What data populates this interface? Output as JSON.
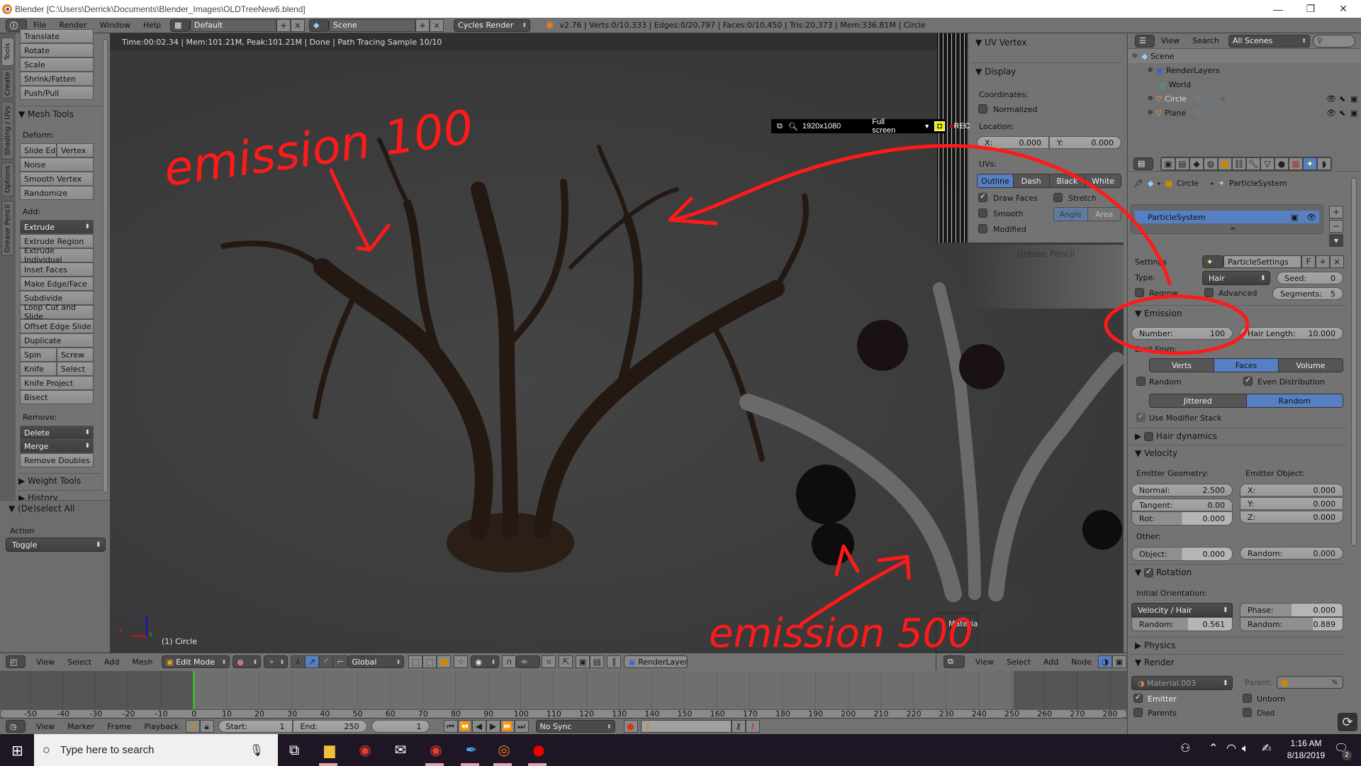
{
  "window": {
    "title": "Blender [C:\\Users\\Derrick\\Documents\\Blender_Images\\OLDTreeNew6.blend]",
    "controls": {
      "minimize": "—",
      "maximize": "❐",
      "close": "✕"
    }
  },
  "topbar": {
    "menus": [
      "File",
      "Render",
      "Window",
      "Help"
    ],
    "layout": "Default",
    "scene": "Scene",
    "engine": "Cycles Render",
    "stats": "v2.76 | Verts:0/10,333 | Edges:0/20,797 | Faces:0/10,450 | Tris:20,373 | Mem:336.81M | Circle"
  },
  "left_tabs": [
    "Tools",
    "Create",
    "Shading / UVs",
    "Options",
    "Grease Pencil"
  ],
  "tool_shelf": {
    "transform_buttons": [
      "Translate",
      "Rotate",
      "Scale",
      "Shrink/Fatten",
      "Push/Pull"
    ],
    "mesh_tools_header": "Mesh Tools",
    "deform_label": "Deform:",
    "deform_row": [
      "Slide Ed",
      "Vertex"
    ],
    "deform_buttons": [
      "Noise",
      "Smooth Vertex",
      "Randomize"
    ],
    "add_label": "Add:",
    "extrude_dropdown": "Extrude",
    "add_buttons": [
      "Extrude Region",
      "Extrude Individual",
      "Inset Faces",
      "Make Edge/Face",
      "Subdivide",
      "Loop Cut and Slide",
      "Offset Edge Slide",
      "Duplicate"
    ],
    "spin_row": [
      "Spin",
      "Screw"
    ],
    "knife_row": [
      "Knife",
      "Select"
    ],
    "more_buttons": [
      "Knife Project",
      "Bisect"
    ],
    "remove_label": "Remove:",
    "delete_dropdown": "Delete",
    "merge_dropdown": "Merge",
    "remove_doubles": "Remove Doubles",
    "weight_tools": "Weight Tools",
    "history": "History"
  },
  "redo_panel": {
    "header": "(De)select All",
    "action_label": "Action",
    "action_value": "Toggle"
  },
  "viewport": {
    "render_info": "Time:00:02.34 | Mem:101.21M, Peak:101.21M | Done | Path Tracing Sample 10/10",
    "object_label": "(1) Circle",
    "axis": {
      "x": "x",
      "y": "y",
      "z": "z"
    },
    "material_preview": "Materia",
    "faded_panel": "Grease Pencil"
  },
  "uv_panel": {
    "uv_vertex_header": "UV Vertex",
    "display_header": "Display",
    "coordinates_label": "Coordinates:",
    "normalized": {
      "label": "Normalized",
      "checked": false
    },
    "location_label": "Location:",
    "x_label": "X:",
    "x_value": "0.000",
    "y_label": "Y:",
    "y_value": "0.000",
    "uvs_label": "UVs:",
    "uv_modes": [
      "Outline",
      "Dash",
      "Black",
      "White"
    ],
    "uv_mode_active": "Outline",
    "draw_faces": {
      "label": "Draw Faces",
      "checked": true
    },
    "stretch": {
      "label": "Stretch",
      "checked": false
    },
    "smooth": {
      "label": "Smooth",
      "checked": false
    },
    "stretch_modes": [
      "Angle",
      "Area"
    ],
    "modified": {
      "label": "Modified",
      "checked": false
    }
  },
  "recorder": {
    "resolution": "1920x1080",
    "mode": "Full screen",
    "rec_label": "REC"
  },
  "outliner": {
    "menus": [
      "View",
      "Search"
    ],
    "filter": "All Scenes",
    "tree": [
      {
        "name": "Scene",
        "level": 0
      },
      {
        "name": "RenderLayers",
        "level": 1
      },
      {
        "name": "World",
        "level": 1
      },
      {
        "name": "Circle",
        "level": 1
      },
      {
        "name": "Plane",
        "level": 1
      }
    ]
  },
  "properties": {
    "breadcrumb": [
      "Circle",
      "ParticleSystem"
    ],
    "particle_system": "ParticleSystem",
    "settings_label": "Settings",
    "settings_value": "ParticleSettings",
    "settings_users": "F",
    "type_label": "Type:",
    "type_value": "Hair",
    "seed_label": "Seed:",
    "seed_value": "0",
    "regrow": {
      "label": "Regrow",
      "checked": false
    },
    "advanced": {
      "label": "Advanced",
      "checked": false
    },
    "segments_label": "Segments:",
    "segments_value": "5",
    "emission": {
      "header": "Emission",
      "number_label": "Number:",
      "number_value": "100",
      "hair_length_label": "Hair Length:",
      "hair_length_value": "10.000",
      "emit_from_label": "Emit From:",
      "emit_from": [
        "Verts",
        "Faces",
        "Volume"
      ],
      "emit_from_active": "Faces",
      "random": {
        "label": "Random",
        "checked": false
      },
      "even_distribution": {
        "label": "Even Distribution",
        "checked": true
      },
      "distribution": [
        "Jittered",
        "Random"
      ],
      "distribution_active": "Random",
      "use_modifier_stack": {
        "label": "Use Modifier Stack",
        "checked": true
      }
    },
    "hair_dynamics": {
      "label": "Hair dynamics",
      "checked": false
    },
    "velocity": {
      "header": "Velocity",
      "emitter_geometry": "Emitter Geometry:",
      "emitter_object": "Emitter Object:",
      "normal_label": "Normal:",
      "normal_value": "2.500",
      "tangent_label": "Tangent:",
      "tangent_value": "0.00",
      "rot_label": "Rot:",
      "rot_value": "0.000",
      "x_label": "X:",
      "x_value": "0.000",
      "y_label": "Y:",
      "y_value": "0.000",
      "z_label": "Z:",
      "z_value": "0.000",
      "other_label": "Other:",
      "object_label": "Object:",
      "object_value": "0.000",
      "random_label": "Random:",
      "random_value": "0.000"
    },
    "rotation": {
      "header": "Rotation",
      "checked": true,
      "initial_orientation": "Initial Orientation:",
      "orientation_value": "Velocity / Hair",
      "random_label": "Random:",
      "random_value": "0.561",
      "phase_label": "Phase:",
      "phase_value": "0.000",
      "random2_label": "Random:",
      "random2_value": "0.889"
    },
    "physics_header": "Physics",
    "render": {
      "header": "Render",
      "material": "Material.003",
      "parent_label": "Parent:",
      "emitter": {
        "label": "Emitter",
        "checked": true
      },
      "unborn": {
        "label": "Unborn",
        "checked": false
      },
      "parents": "Parents",
      "died": "Died"
    }
  },
  "view3d_header": {
    "menus": [
      "View",
      "Select",
      "Add",
      "Mesh"
    ],
    "mode": "Edit Mode",
    "orientation": "Global",
    "render_layer": "RenderLayer"
  },
  "node_header": {
    "menus": [
      "View",
      "Select",
      "Add",
      "Node"
    ]
  },
  "timeline": {
    "ticks": [
      -50,
      -40,
      -30,
      -20,
      -10,
      0,
      10,
      20,
      30,
      40,
      50,
      60,
      70,
      80,
      90,
      100,
      110,
      120,
      130,
      140,
      150,
      160,
      170,
      180,
      190,
      200,
      210,
      220,
      230,
      240,
      250,
      260,
      270,
      280
    ],
    "current_frame_marker": 0,
    "menus": [
      "View",
      "Marker",
      "Frame",
      "Playback"
    ],
    "start_label": "Start:",
    "start_value": "1",
    "end_label": "End:",
    "end_value": "250",
    "current_frame": "1",
    "sync": "No Sync"
  },
  "annotations": {
    "text_top": "emission 100",
    "text_bottom": "emission 500",
    "color": "#ff1a1a"
  },
  "taskbar": {
    "search_placeholder": "Type here to search",
    "time": "1:16 AM",
    "date": "8/18/2019",
    "notifications": "2"
  },
  "colors": {
    "blender_panel": "#737373",
    "viewport_bg": "#3e3e3e",
    "active_blue": "#5680c2",
    "annotation_red": "#ff1a1a"
  }
}
